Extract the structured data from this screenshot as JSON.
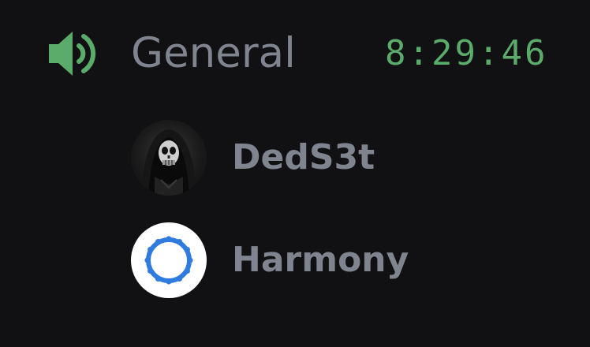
{
  "voice_channel": {
    "name": "General",
    "elapsed_time": "8:29:46",
    "icon": "speaker-icon"
  },
  "participants": [
    {
      "name": "DedS3t",
      "avatar": "hooded-skull-avatar"
    },
    {
      "name": "Harmony",
      "avatar": "blue-ring-avatar"
    }
  ],
  "colors": {
    "background": "#111113",
    "muted_text": "#80848e",
    "accent_green": "#5bab6b",
    "harmony_blue": "#2f7be0"
  }
}
